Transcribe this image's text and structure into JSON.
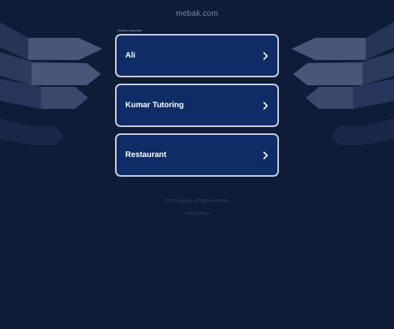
{
  "site": {
    "domain": "mebak.com"
  },
  "searches": {
    "label": "Related searches",
    "items": [
      {
        "label": "Ali"
      },
      {
        "label": "Kumar Tutoring"
      },
      {
        "label": "Restaurant"
      }
    ]
  },
  "footer": {
    "disclaimer": "2025 Copyright. All Rights Reserved.",
    "privacy": "Privacy Policy"
  },
  "colors": {
    "background": "#0f1c38",
    "card_fill": "#0f2c66",
    "card_border": "#c9cfdc",
    "text": "#ffffff"
  },
  "icons": {
    "chevron": "chevron-right-icon"
  }
}
